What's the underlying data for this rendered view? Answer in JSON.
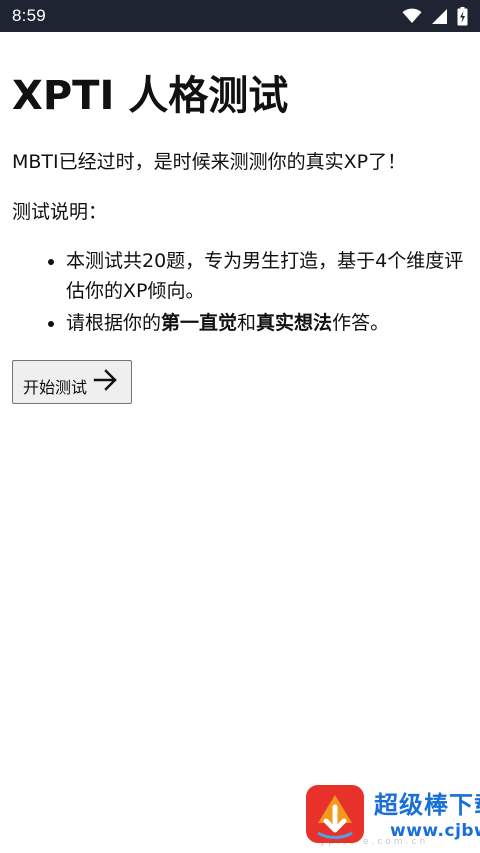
{
  "status_bar": {
    "time": "8:59",
    "icons": [
      "wifi-icon",
      "cellular-signal-icon",
      "battery-charging-icon"
    ]
  },
  "page": {
    "title": "XPTI 人格测试",
    "intro": "MBTI已经过时，是时候来测测你的真实XP了！",
    "section_label": "测试说明：",
    "rules": [
      {
        "text": "本测试共20题，专为男生打造，基于4个维度评估你的XP倾向。"
      },
      {
        "prefix": "请根据你的",
        "bold1": "第一直觉",
        "middle": "和",
        "bold2": "真实想法",
        "suffix": "作答。"
      }
    ],
    "start_button_label": "开始测试",
    "start_button_icon": "arrow-right-icon"
  },
  "watermark": {
    "title": "超级棒下载站",
    "url": "www.cjbwh.cn",
    "faint_text": "ypric e.com.cn",
    "colors": {
      "text": "#1a6fd6",
      "logo_red": "#e8312a",
      "logo_orange": "#f39a1e"
    }
  },
  "colors": {
    "status_bar_bg": "#1f2433",
    "button_bg": "#efefef",
    "button_border": "#767676"
  }
}
